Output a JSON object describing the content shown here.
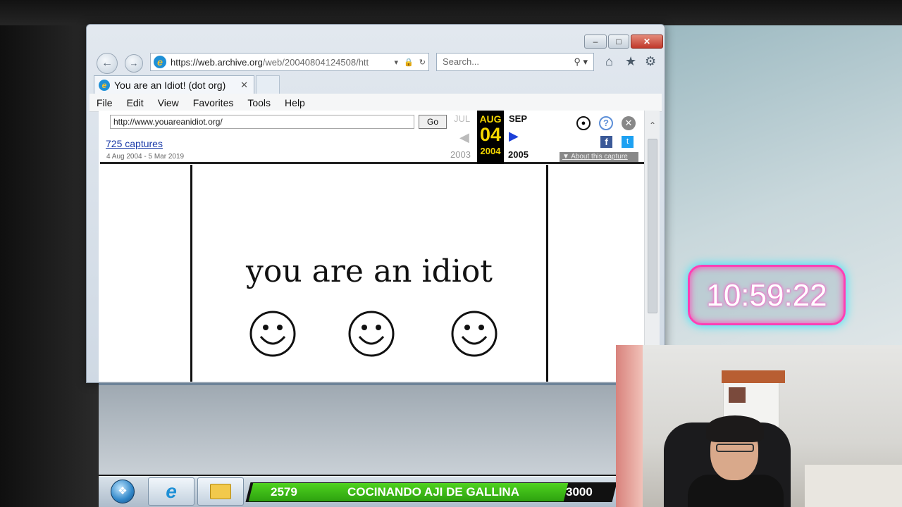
{
  "browser": {
    "address": {
      "url_prefix": "https://web.",
      "url_domain": "archive.org",
      "url_rest": "/web/20040804124508/htt"
    },
    "search_placeholder": "Search...",
    "tab_title": "You are an Idiot! (dot org)",
    "menu": [
      "File",
      "Edit",
      "View",
      "Favorites",
      "Tools",
      "Help"
    ]
  },
  "wayback": {
    "url_value": "http://www.youareanidiot.org/",
    "go_label": "Go",
    "captures_label": "725 captures",
    "date_range": "4 Aug 2004 - 5 Mar 2019",
    "prev_month": "JUL",
    "current_month": "AUG",
    "next_month": "SEP",
    "current_day": "04",
    "prev_year": "2003",
    "current_year": "2004",
    "next_year": "2005",
    "about_label": "▼ About this capture"
  },
  "page": {
    "headline": "you are an idiot"
  },
  "overlay": {
    "clock": "10:59:22",
    "goal_current": "2579",
    "goal_title": "COCINANDO AJI DE GALLINA",
    "goal_target": "3000",
    "goal_progress": 0.86
  },
  "colors": {
    "wayback_yellow": "#f5d700",
    "goal_green": "#3fc01a",
    "clock_pink": "#ff3fb4",
    "clock_cyan": "#23e6ff"
  }
}
